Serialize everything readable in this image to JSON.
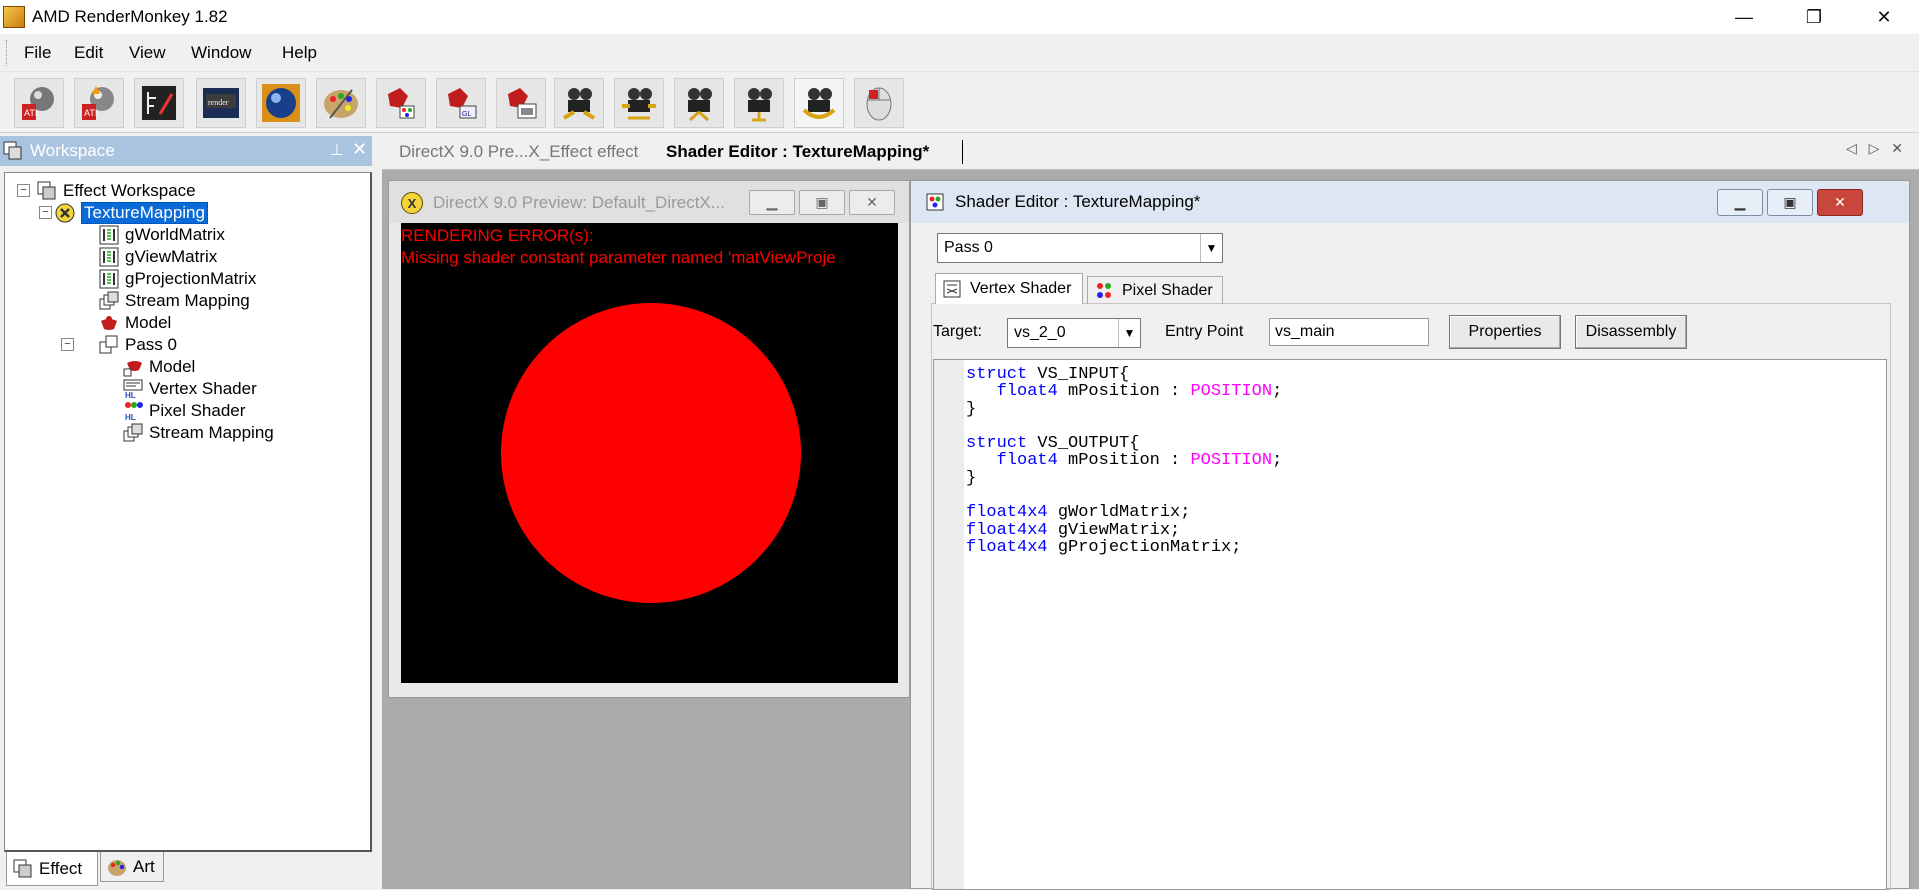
{
  "window": {
    "title": "AMD RenderMonkey 1.82",
    "controls": {
      "minimize": "—",
      "restore": "❐",
      "close": "✕"
    }
  },
  "menu": [
    "File",
    "Edit",
    "View",
    "Window",
    "Help"
  ],
  "toolbar": {
    "buttons": [
      "add-directx-effect-icon",
      "add-opengl-effect-icon",
      "shader-editor-icon",
      "render-icon",
      "sphere-preview-icon",
      "palette-icon",
      "red-shape-icon",
      "red-shape-ogl-icon",
      "red-shape-window-icon",
      "camera-icon-1",
      "camera-icon-2",
      "camera-icon-3",
      "camera-icon-4",
      "camera-icon-5",
      "mouse-icon"
    ],
    "render_label": "render"
  },
  "workspace": {
    "title": "Workspace",
    "pin": "⊥",
    "close": "✕",
    "tree": [
      {
        "label": "Effect Workspace",
        "icon": "workspace-icon",
        "level": 0,
        "expander": "−"
      },
      {
        "label": "TextureMapping",
        "icon": "effect-icon",
        "level": 1,
        "expander": "−",
        "selected": true
      },
      {
        "label": "gWorldMatrix",
        "icon": "matrix-icon",
        "level": 2
      },
      {
        "label": "gViewMatrix",
        "icon": "matrix-icon",
        "level": 2
      },
      {
        "label": "gProjectionMatrix",
        "icon": "matrix-icon",
        "level": 2
      },
      {
        "label": "Stream Mapping",
        "icon": "stream-mapping-icon",
        "level": 2
      },
      {
        "label": "Model",
        "icon": "model-icon",
        "level": 2
      },
      {
        "label": "Pass 0",
        "icon": "pass-icon",
        "level": 2,
        "expander": "−"
      },
      {
        "label": "Model",
        "icon": "model-ref-icon",
        "level": 3
      },
      {
        "label": "Vertex Shader",
        "icon": "vertex-shader-icon",
        "level": 3
      },
      {
        "label": "Pixel Shader",
        "icon": "pixel-shader-icon",
        "level": 3
      },
      {
        "label": "Stream Mapping",
        "icon": "stream-mapping-icon",
        "level": 3
      }
    ],
    "bottom_tabs": [
      "Effect",
      "Art"
    ]
  },
  "doc_tabs": [
    {
      "label": "DirectX 9.0 Pre...X_Effect effect",
      "active": false
    },
    {
      "label": "Shader Editor : TextureMapping*",
      "active": true
    }
  ],
  "doc_nav": "◁ ▷ ✕",
  "preview": {
    "title": "DirectX 9.0 Preview: Default_DirectX...",
    "icon_letter": "X",
    "error_title": "RENDERING ERROR(s):",
    "error_message": "Missing shader constant parameter named 'matViewProje",
    "shape_color": "#ff0000"
  },
  "shader_editor": {
    "title": "Shader Editor : TextureMapping*",
    "pass": "Pass 0",
    "tabs": [
      "Vertex Shader",
      "Pixel Shader"
    ],
    "target_label": "Target:",
    "target_value": "vs_2_0",
    "entry_label": "Entry Point",
    "entry_value": "vs_main",
    "properties_button": "Properties",
    "disassembly_button": "Disassembly",
    "code_lines": [
      [
        {
          "t": "struct",
          "c": "kw"
        },
        {
          "t": " VS_INPUT{"
        }
      ],
      [
        {
          "t": "   "
        },
        {
          "t": "float4",
          "c": "kw"
        },
        {
          "t": " mPosition : "
        },
        {
          "t": "POSITION",
          "c": "sem"
        },
        {
          "t": ";"
        }
      ],
      [
        {
          "t": "}"
        }
      ],
      [
        {
          "t": ""
        }
      ],
      [
        {
          "t": "struct",
          "c": "kw"
        },
        {
          "t": " VS_OUTPUT{"
        }
      ],
      [
        {
          "t": "   "
        },
        {
          "t": "float4",
          "c": "kw"
        },
        {
          "t": " mPosition : "
        },
        {
          "t": "POSITION",
          "c": "sem"
        },
        {
          "t": ";"
        }
      ],
      [
        {
          "t": "}"
        }
      ],
      [
        {
          "t": ""
        }
      ],
      [
        {
          "t": "float4x4",
          "c": "kw"
        },
        {
          "t": " gWorldMatrix;"
        }
      ],
      [
        {
          "t": "float4x4",
          "c": "kw"
        },
        {
          "t": " gViewMatrix;"
        }
      ],
      [
        {
          "t": "float4x4",
          "c": "kw"
        },
        {
          "t": " gProjectionMatrix;"
        }
      ]
    ]
  },
  "colors": {
    "workspace_header": "#aac3de",
    "selection": "#0a6ad6",
    "keyword": "#0000ff",
    "semantic": "#ff00ff",
    "error_text": "#ff0000"
  }
}
